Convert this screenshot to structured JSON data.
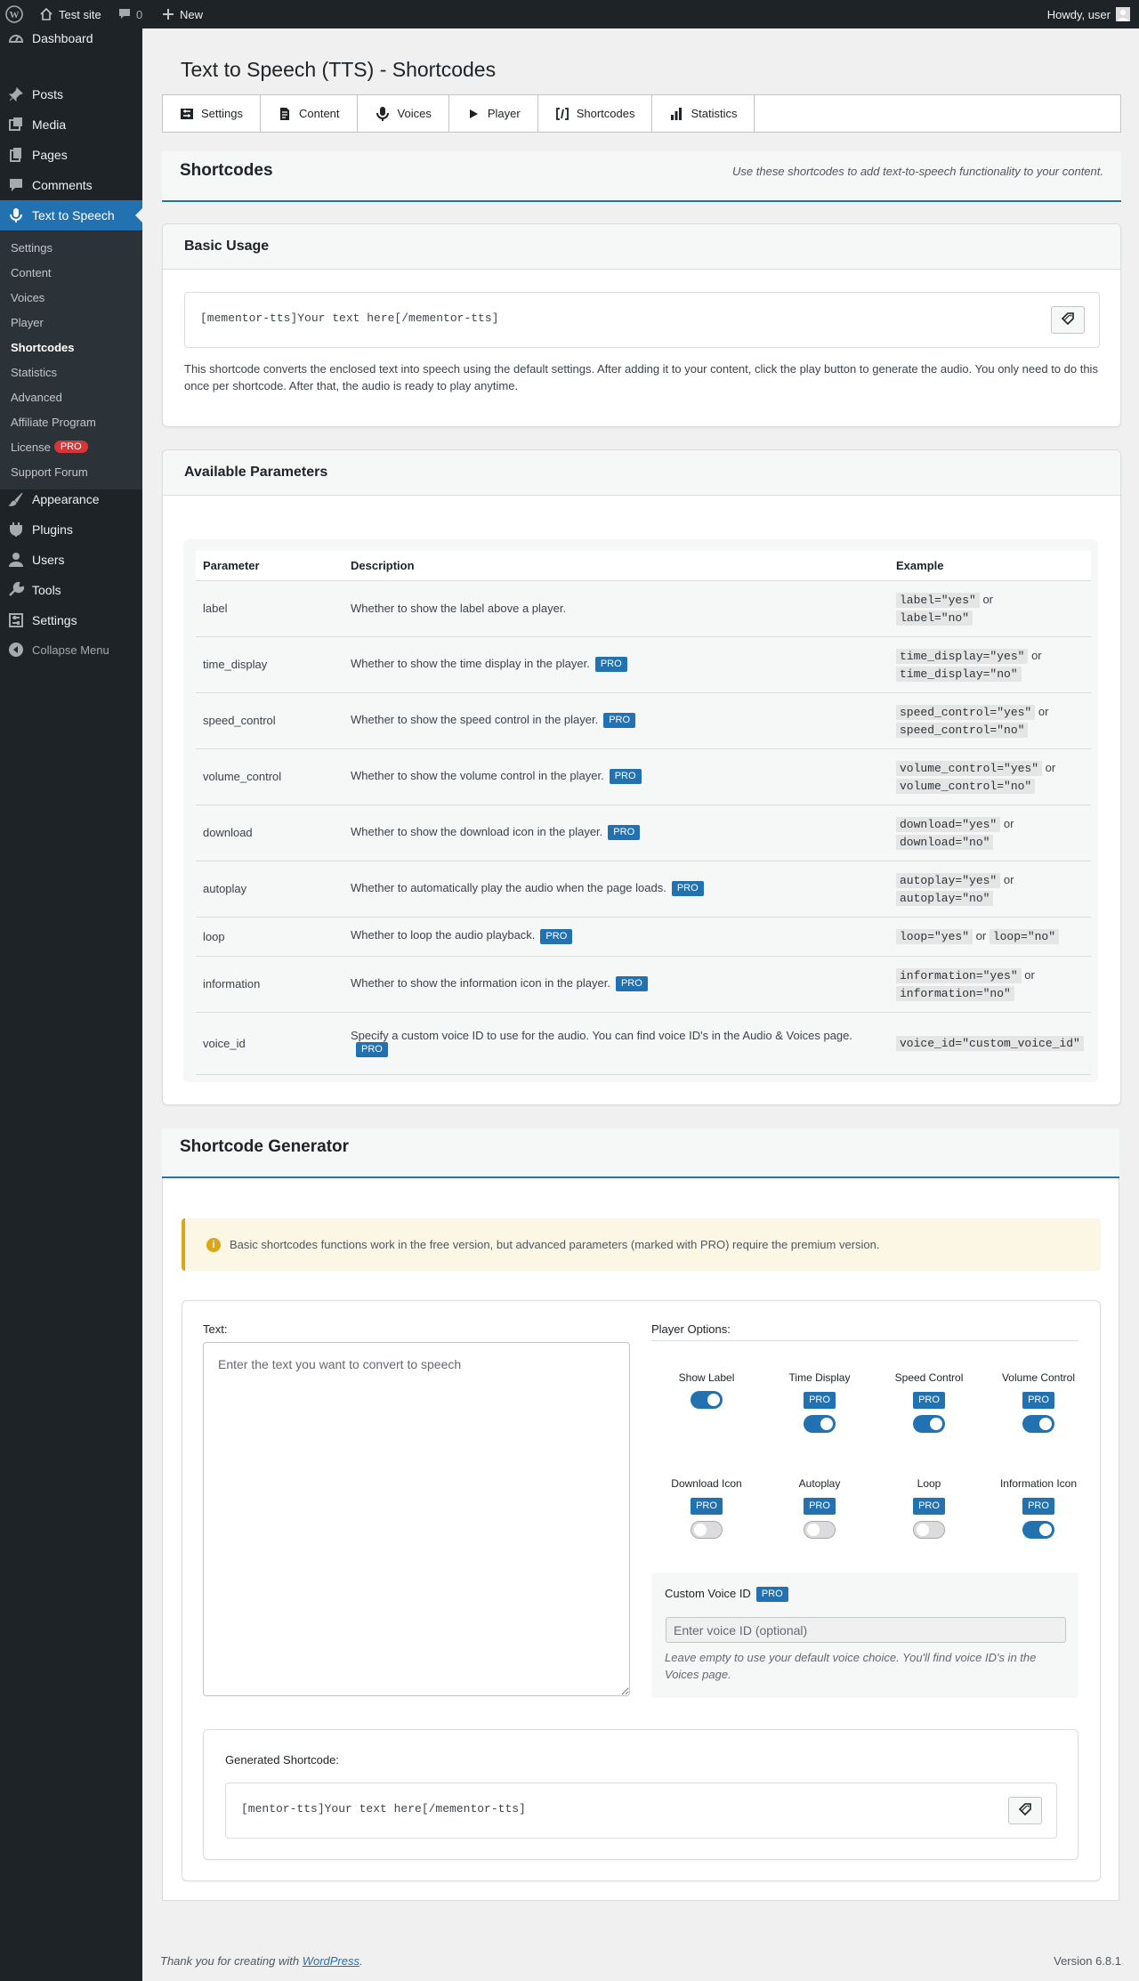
{
  "admin_bar": {
    "site_name": "Test site",
    "comments_count": "0",
    "new_label": "New",
    "howdy": "Howdy, user"
  },
  "sidebar": {
    "menu": [
      {
        "label": "Dashboard",
        "icon": "dashboard-icon"
      },
      {
        "label": "Posts",
        "icon": "pushpin-icon"
      },
      {
        "label": "Media",
        "icon": "media-icon"
      },
      {
        "label": "Pages",
        "icon": "pages-icon"
      },
      {
        "label": "Comments",
        "icon": "comment-icon"
      },
      {
        "label": "Text to Speech",
        "icon": "microphone-icon"
      },
      {
        "label": "Appearance",
        "icon": "brush-icon"
      },
      {
        "label": "Plugins",
        "icon": "plugin-icon"
      },
      {
        "label": "Users",
        "icon": "users-icon"
      },
      {
        "label": "Tools",
        "icon": "wrench-icon"
      },
      {
        "label": "Settings",
        "icon": "settings-icon"
      },
      {
        "label": "Collapse Menu",
        "icon": "collapse-icon"
      }
    ],
    "submenu": [
      "Settings",
      "Content",
      "Voices",
      "Player",
      "Shortcodes",
      "Statistics",
      "Advanced",
      "Affiliate Program",
      "License",
      "Support Forum"
    ],
    "license_badge": "PRO",
    "current_submenu": "Shortcodes"
  },
  "page": {
    "title": "Text to Speech (TTS) - Shortcodes"
  },
  "tabs": [
    {
      "label": "Settings",
      "icon": "sliders-icon"
    },
    {
      "label": "Content",
      "icon": "document-icon"
    },
    {
      "label": "Voices",
      "icon": "microphone-icon"
    },
    {
      "label": "Player",
      "icon": "play-icon"
    },
    {
      "label": "Shortcodes",
      "icon": "shortcode-icon"
    },
    {
      "label": "Statistics",
      "icon": "chart-bars-icon"
    }
  ],
  "shortcodes_section": {
    "title": "Shortcodes",
    "subtitle": "Use these shortcodes to add text-to-speech functionality to your content."
  },
  "basic_usage": {
    "title": "Basic Usage",
    "code": "[mementor-tts]Your text here[/mementor-tts]",
    "description": "This shortcode converts the enclosed text into speech using the default settings. After adding it to your content, click the play button to generate the audio. You only need to do this once per shortcode. After that, the audio is ready to play anytime."
  },
  "parameters": {
    "title": "Available Parameters",
    "headers": [
      "Parameter",
      "Description",
      "Example"
    ],
    "pro_label": "PRO",
    "or_word": "or",
    "rows": [
      {
        "name": "label",
        "desc": "Whether to show the label above a player.",
        "pro": false,
        "ex1": "label=\"yes\"",
        "ex2": "label=\"no\""
      },
      {
        "name": "time_display",
        "desc": "Whether to show the time display in the player.",
        "pro": true,
        "ex1": "time_display=\"yes\"",
        "ex2": "time_display=\"no\""
      },
      {
        "name": "speed_control",
        "desc": "Whether to show the speed control in the player.",
        "pro": true,
        "ex1": "speed_control=\"yes\"",
        "ex2": "speed_control=\"no\""
      },
      {
        "name": "volume_control",
        "desc": "Whether to show the volume control in the player.",
        "pro": true,
        "ex1": "volume_control=\"yes\"",
        "ex2": "volume_control=\"no\""
      },
      {
        "name": "download",
        "desc": "Whether to show the download icon in the player.",
        "pro": true,
        "ex1": "download=\"yes\"",
        "ex2": "download=\"no\""
      },
      {
        "name": "autoplay",
        "desc": "Whether to automatically play the audio when the page loads.",
        "pro": true,
        "ex1": "autoplay=\"yes\"",
        "ex2": "autoplay=\"no\""
      },
      {
        "name": "loop",
        "desc": "Whether to loop the audio playback.",
        "pro": true,
        "ex1": "loop=\"yes\"",
        "ex2": "loop=\"no\""
      },
      {
        "name": "information",
        "desc": "Whether to show the information icon in the player.",
        "pro": true,
        "ex1": "information=\"yes\"",
        "ex2": "information=\"no\""
      },
      {
        "name": "voice_id",
        "desc": "Specify a custom voice ID to use for the audio. You can find voice ID's in the Audio & Voices page.",
        "pro": true,
        "ex1": "voice_id=\"custom_voice_id\"",
        "ex2": ""
      }
    ]
  },
  "generator": {
    "title": "Shortcode Generator",
    "notice": "Basic shortcodes functions work in the free version, but advanced parameters (marked with PRO) require the premium version.",
    "text_label": "Text:",
    "text_placeholder": "Enter the text you want to convert to speech",
    "text_value": "",
    "options_label": "Player Options:",
    "options": [
      {
        "label": "Show Label",
        "pro": false,
        "on": true
      },
      {
        "label": "Time Display",
        "pro": true,
        "on": true
      },
      {
        "label": "Speed Control",
        "pro": true,
        "on": true
      },
      {
        "label": "Volume Control",
        "pro": true,
        "on": true
      },
      {
        "label": "Download Icon",
        "pro": true,
        "on": false
      },
      {
        "label": "Autoplay",
        "pro": true,
        "on": false
      },
      {
        "label": "Loop",
        "pro": true,
        "on": false
      },
      {
        "label": "Information Icon",
        "pro": true,
        "on": true
      }
    ],
    "voice_id_label": "Custom Voice ID",
    "voice_id_placeholder": "Enter voice ID (optional)",
    "voice_id_value": "",
    "voice_id_help": "Leave empty to use your default voice choice. You'll find voice ID's in the Voices page.",
    "generated_label": "Generated Shortcode:",
    "generated_code": "[mentor-tts]Your text here[/mementor-tts]"
  },
  "footer": {
    "thanks_prefix": "Thank you for creating with",
    "wp_link": "WordPress",
    "thanks_suffix": ".",
    "version": "Version 6.8.1"
  },
  "colors": {
    "accent": "#2271b1",
    "admin_bar": "#1d2327",
    "notice": "#dba617",
    "pro_badge": "#2271b1"
  }
}
